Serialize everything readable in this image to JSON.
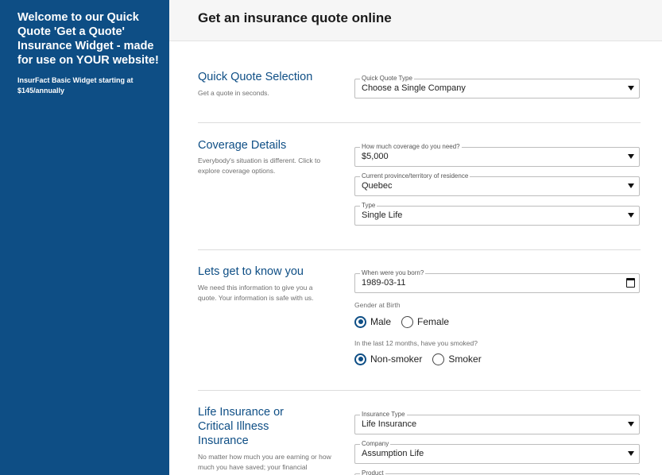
{
  "sidebar": {
    "title": "Welcome to our Quick Quote 'Get a Quote' Insurance Widget - made for use on YOUR website!",
    "subtitle": "InsurFact Basic Widget starting at $145/annually"
  },
  "header": {
    "title": "Get an insurance quote online"
  },
  "sections": {
    "quick_quote": {
      "title": "Quick Quote Selection",
      "desc": "Get a quote in seconds.",
      "quote_type": {
        "label": "Quick Quote Type",
        "value": "Choose a Single Company"
      }
    },
    "coverage": {
      "title": "Coverage Details",
      "desc": "Everybody's situation is different. Click to explore coverage options.",
      "amount": {
        "label": "How much coverage do you need?",
        "value": "$5,000"
      },
      "province": {
        "label": "Current province/territory of residence",
        "value": "Quebec"
      },
      "type": {
        "label": "Type",
        "value": "Single Life"
      }
    },
    "about_you": {
      "title": "Lets get to know you",
      "desc": "We need this information to give you a quote. Your information is safe with us.",
      "birth": {
        "label": "When were you born?",
        "value": "1989-03-11"
      },
      "gender": {
        "label": "Gender at Birth",
        "options": [
          "Male",
          "Female"
        ],
        "selected": "Male"
      },
      "smoker": {
        "label": "In the last 12 months, have you smoked?",
        "options": [
          "Non-smoker",
          "Smoker"
        ],
        "selected": "Non-smoker"
      }
    },
    "insurance": {
      "title": "Life Insurance or Critical Illness Insurance",
      "desc": "No matter how much you are earning or how much you have saved; your financial",
      "ins_type": {
        "label": "Insurance Type",
        "value": "Life Insurance"
      },
      "company": {
        "label": "Company",
        "value": "Assumption Life"
      },
      "product": {
        "label": "Product"
      }
    }
  }
}
